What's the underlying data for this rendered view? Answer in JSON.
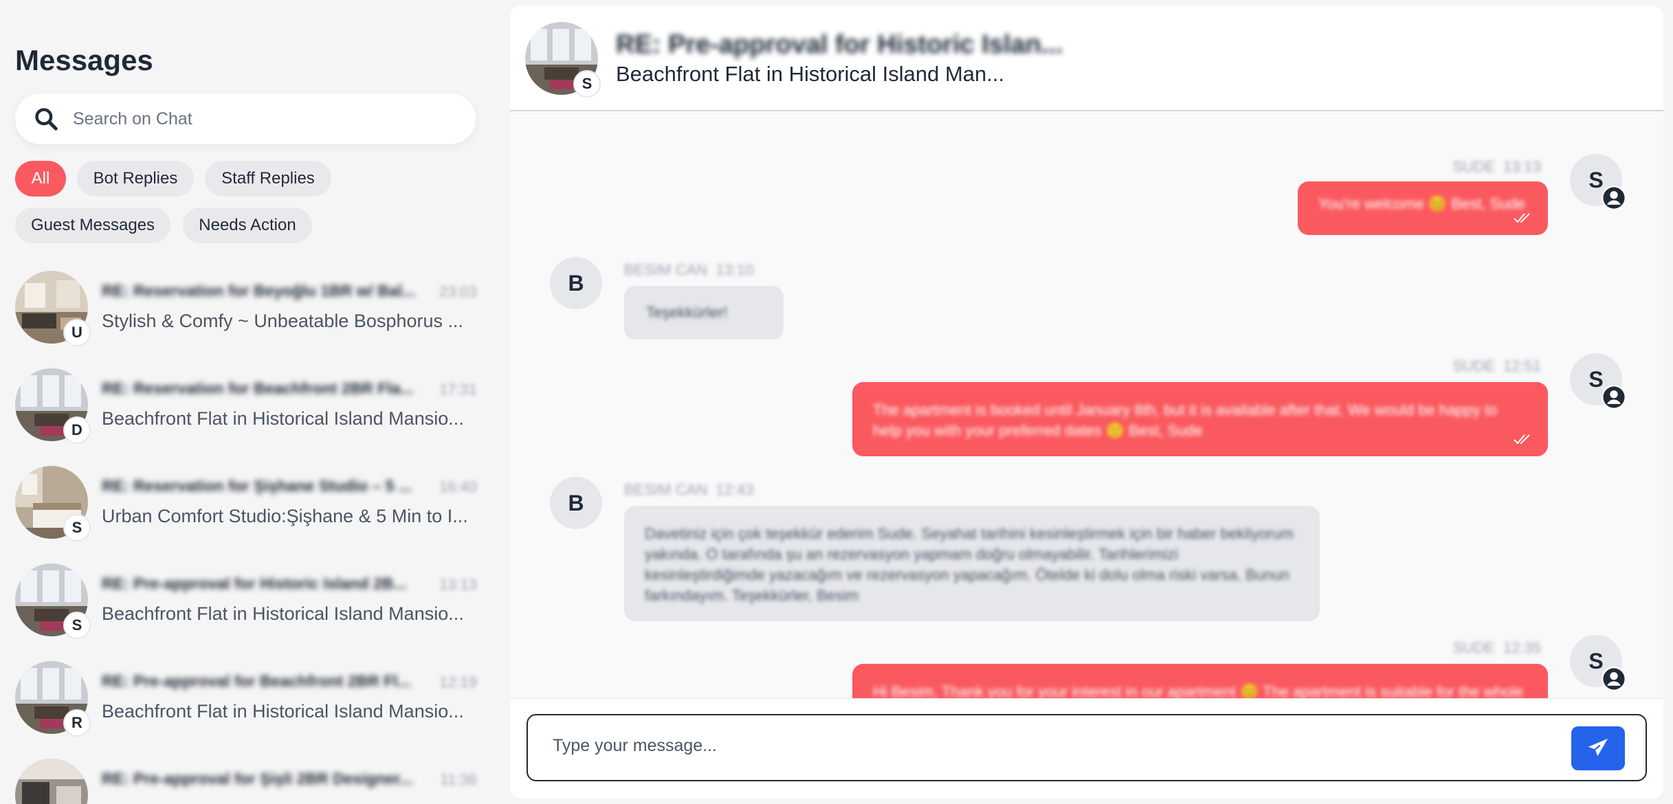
{
  "sidebar": {
    "title": "Messages",
    "search_placeholder": "Search on Chat",
    "filters": [
      "All",
      "Bot Replies",
      "Staff Replies",
      "Guest Messages",
      "Needs Action"
    ],
    "active_filter": "All",
    "conversations": [
      {
        "title": "RE: Reservation for Beyoğlu 1BR w/ Bal...",
        "time": "23:03",
        "subtitle": "Stylish & Comfy ~ Unbeatable Bosphorus ...",
        "badge": "U"
      },
      {
        "title": "RE: Reservation for Beachfront 2BR Fla...",
        "time": "17:31",
        "subtitle": "Beachfront Flat in Historical Island Mansio...",
        "badge": "D"
      },
      {
        "title": "RE: Reservation for Şişhane Studio – 5 ...",
        "time": "16:40",
        "subtitle": "Urban Comfort Studio:Şişhane & 5 Min to I...",
        "badge": "S"
      },
      {
        "title": "RE: Pre-approval for Historic Island 2B...",
        "time": "13:13",
        "subtitle": "Beachfront Flat in Historical Island Mansio...",
        "badge": "S"
      },
      {
        "title": "RE: Pre-approval for Beachfront 2BR Fl...",
        "time": "12:19",
        "subtitle": "Beachfront Flat in Historical Island Mansio...",
        "badge": "R"
      },
      {
        "title": "RE: Pre-approval for Şişli 2BR Designer...",
        "time": "11:36",
        "subtitle": "",
        "badge": ""
      }
    ]
  },
  "chat": {
    "header": {
      "title": "RE: Pre-approval for Historic Islan...",
      "subtitle": "Beachfront Flat in Historical Island Man...",
      "badge": "S"
    },
    "messages": [
      {
        "direction": "out",
        "sender": "SUDE",
        "time": "13:13",
        "initial": "S",
        "text": "You're welcome 😊 Best, Sude"
      },
      {
        "direction": "in",
        "sender": "BESIM CAN",
        "time": "13:10",
        "initial": "B",
        "text": "Teşekkürler!"
      },
      {
        "direction": "out",
        "sender": "SUDE",
        "time": "12:51",
        "initial": "S",
        "text": "The apartment is booked until January 8th, but it is available after that. We would be happy to help you with your preferred dates 🙂 Best, Sude"
      },
      {
        "direction": "in",
        "sender": "BESIM CAN",
        "time": "12:43",
        "initial": "B",
        "text": "Davetiniz için çok teşekkür ederim Sude. Seyahat tarihini kesinleştirmek için bir haber bekliyorum yakında. O tarafında şu an rezervasyon yapmam doğru olmayabilir. Tarihlerimizi kesinleştirdiğimde yazacağım ve rezervasyon yapacağım. Ötelde ki dolu olma riski varsa. Bunun farkındayım. Teşekkürler, Besim"
      },
      {
        "direction": "out",
        "sender": "SUDE",
        "time": "12:35",
        "initial": "S",
        "text": "Hi Besim, Thank you for your interest in our apartment 😊 The apartment is suitable for the whole family"
      }
    ]
  },
  "composer": {
    "placeholder": "Type your message...",
    "send_icon": "paper-plane-icon"
  },
  "colors": {
    "accent": "#fa5a5f",
    "send": "#2563eb",
    "incoming_bubble": "#e5e7eb"
  }
}
